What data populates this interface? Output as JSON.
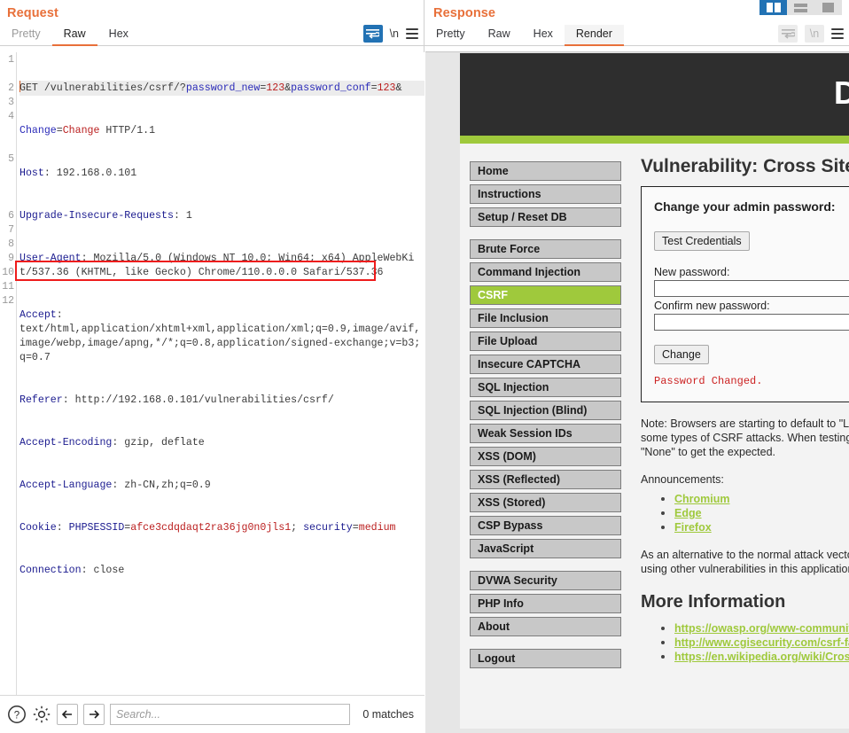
{
  "window": {
    "layout_toggles": [
      {
        "name": "split-vertical",
        "selected": true
      },
      {
        "name": "split-horizontal",
        "selected": false
      },
      {
        "name": "single-pane",
        "selected": false
      }
    ]
  },
  "request": {
    "title": "Request",
    "tabs": [
      {
        "label": "Pretty",
        "active": false,
        "enabled": false
      },
      {
        "label": "Raw",
        "active": true,
        "enabled": true
      },
      {
        "label": "Hex",
        "active": false,
        "enabled": true
      }
    ],
    "tools": {
      "wrap_icon": "word-wrap-icon",
      "wrap_active": true,
      "newline_label": "\\n",
      "menu_icon": "hamburger-menu-icon"
    },
    "gutter_lines": [
      "1",
      "2",
      "3",
      "4",
      "5",
      "6",
      "7",
      "8",
      "9",
      "10",
      "11",
      "12"
    ],
    "http": {
      "line1_method": "GET",
      "line1_path": " /vulnerabilities/csrf/?",
      "line1_p1_name": "password_new",
      "line1_p1_eq": "=",
      "line1_p1_val": "123",
      "line1_amp1": "&",
      "line1_p2_name": "password_conf",
      "line1_p2_eq": "=",
      "line1_p2_val": "123",
      "line1_amp2": "&",
      "line1b_p3_name": "Change",
      "line1b_p3_eq": "=",
      "line1b_p3_val": "Change",
      "line1b_ver": " HTTP/1.1",
      "h2_name": "Host",
      "h2_val": "192.168.0.101",
      "h3_name": "Upgrade-Insecure-Requests",
      "h3_val": "1",
      "h4_name": "User-Agent",
      "h4_val": "Mozilla/5.0 (Windows NT 10.0; Win64; x64) AppleWebKit/537.36 (KHTML, like Gecko) Chrome/110.0.0.0 Safari/537.36",
      "h5_name": "Accept",
      "h5_val": "text/html,application/xhtml+xml,application/xml;q=0.9,image/avif,image/webp,image/apng,*/*;q=0.8,application/signed-exchange;v=b3;q=0.7",
      "h6_name": "Referer",
      "h6_val": "http://192.168.0.101/vulnerabilities/csrf/",
      "h7_name": "Accept-Encoding",
      "h7_val": "gzip, deflate",
      "h8_name": "Accept-Language",
      "h8_val": "zh-CN,zh;q=0.9",
      "h9_name": "Cookie",
      "h9_c1_name": "PHPSESSID",
      "h9_c1_val": "afce3cdqdaqt2ra36jg0n0jls1",
      "h9_sep": "; ",
      "h9_c2_name": "security",
      "h9_c2_val": "medium",
      "h10_name": "Connection",
      "h10_val": "close"
    },
    "findbar": {
      "help_icon": "help-circle-icon",
      "settings_icon": "gear-icon",
      "prev_icon": "arrow-left-icon",
      "next_icon": "arrow-right-icon",
      "search_value": "",
      "search_placeholder": "Search...",
      "match_count": "0 matches"
    },
    "highlight_color": "#ee1c1c"
  },
  "response": {
    "title": "Response",
    "tabs": [
      {
        "label": "Pretty",
        "active": false,
        "enabled": true
      },
      {
        "label": "Raw",
        "active": false,
        "enabled": true
      },
      {
        "label": "Hex",
        "active": false,
        "enabled": true
      },
      {
        "label": "Render",
        "active": true,
        "enabled": true
      }
    ],
    "tools": {
      "wrap_icon": "word-wrap-icon",
      "wrap_active": false,
      "newline_label": "\\n",
      "menu_icon": "hamburger-menu-icon"
    }
  },
  "dvwa": {
    "logo": "DVWA",
    "accent_green": "#9fc93c",
    "header_bg": "#2e2e2e",
    "menu_groups": [
      {
        "items": [
          {
            "label": "Home",
            "active": false
          },
          {
            "label": "Instructions",
            "active": false
          },
          {
            "label": "Setup / Reset DB",
            "active": false
          }
        ]
      },
      {
        "items": [
          {
            "label": "Brute Force",
            "active": false
          },
          {
            "label": "Command Injection",
            "active": false
          },
          {
            "label": "CSRF",
            "active": true
          },
          {
            "label": "File Inclusion",
            "active": false
          },
          {
            "label": "File Upload",
            "active": false
          },
          {
            "label": "Insecure CAPTCHA",
            "active": false
          },
          {
            "label": "SQL Injection",
            "active": false
          },
          {
            "label": "SQL Injection (Blind)",
            "active": false
          },
          {
            "label": "Weak Session IDs",
            "active": false
          },
          {
            "label": "XSS (DOM)",
            "active": false
          },
          {
            "label": "XSS (Reflected)",
            "active": false
          },
          {
            "label": "XSS (Stored)",
            "active": false
          },
          {
            "label": "CSP Bypass",
            "active": false
          },
          {
            "label": "JavaScript",
            "active": false
          }
        ]
      },
      {
        "items": [
          {
            "label": "DVWA Security",
            "active": false
          },
          {
            "label": "PHP Info",
            "active": false
          },
          {
            "label": "About",
            "active": false
          }
        ]
      },
      {
        "items": [
          {
            "label": "Logout",
            "active": false
          }
        ]
      }
    ],
    "page_title": "Vulnerability: Cross Site Request Forgery (CSRF)",
    "form": {
      "heading": "Change your admin password:",
      "test_credentials_label": "Test Credentials",
      "new_password_label": "New password:",
      "new_password_value": "",
      "confirm_password_label": "Confirm new password:",
      "confirm_password_value": "",
      "change_label": "Change",
      "result_message": "Password Changed."
    },
    "note": "Note: Browsers are starting to default to \"Lax\" for SameSite cookies, which will break some types of CSRF attacks. When testing, you may need to change this setting to \"None\" to get the expected.",
    "announcements_label": "Announcements:",
    "announcement_links": [
      "Chromium",
      "Edge",
      "Firefox"
    ],
    "alt_note": "As an alternative to the normal attack vector, you can also try to change the password using other vulnerabilities in this application.",
    "more_info_heading": "More Information",
    "more_info_links": [
      "https://owasp.org/www-community/attacks/csrf",
      "http://www.cgisecurity.com/csrf-faq.html",
      "https://en.wikipedia.org/wiki/Cross-site_request_forgery"
    ]
  }
}
